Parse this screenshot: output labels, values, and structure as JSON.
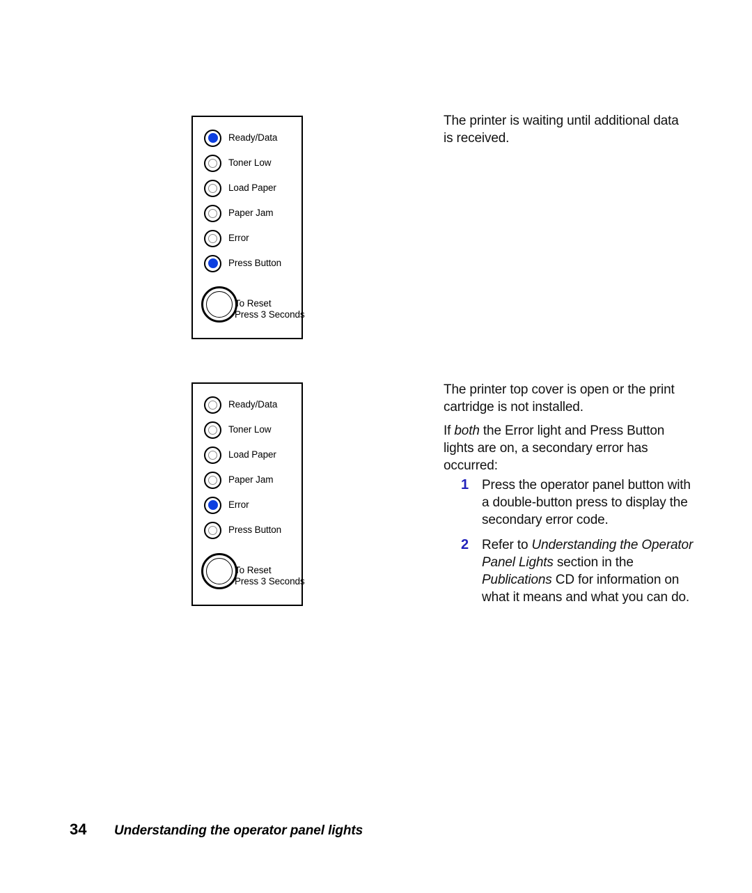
{
  "page": {
    "number": "34",
    "footer_title": "Understanding the operator panel lights"
  },
  "panels": [
    {
      "id": "panel-1",
      "lights": [
        {
          "label": "Ready/Data",
          "state": "on"
        },
        {
          "label": "Toner Low",
          "state": "off"
        },
        {
          "label": "Load Paper",
          "state": "off"
        },
        {
          "label": "Paper Jam",
          "state": "off"
        },
        {
          "label": "Error",
          "state": "off"
        },
        {
          "label": "Press Button",
          "state": "on"
        }
      ],
      "reset": {
        "line1": "To Reset",
        "line2": "Press 3 Seconds"
      }
    },
    {
      "id": "panel-2",
      "lights": [
        {
          "label": "Ready/Data",
          "state": "off"
        },
        {
          "label": "Toner Low",
          "state": "off"
        },
        {
          "label": "Load Paper",
          "state": "off"
        },
        {
          "label": "Paper Jam",
          "state": "off"
        },
        {
          "label": "Error",
          "state": "on"
        },
        {
          "label": "Press Button",
          "state": "off"
        }
      ],
      "reset": {
        "line1": "To Reset",
        "line2": "Press 3 Seconds"
      }
    }
  ],
  "descriptions": {
    "first": "The printer is waiting until additional data is received.",
    "second": "The printer top cover is open or the print cartridge is not installed.",
    "third_prefix": "If ",
    "third_italic": "both",
    "third_suffix": " the Error light and Press Button lights are on, a secondary error has occurred:"
  },
  "steps": [
    {
      "number": "1",
      "text": "Press the operator panel button with a double-button press to display the secondary error code."
    },
    {
      "number": "2",
      "parts": [
        {
          "text": "Refer to ",
          "style": "normal"
        },
        {
          "text": "Understanding the Operator Panel Lights",
          "style": "italic"
        },
        {
          "text": " section in the ",
          "style": "normal"
        },
        {
          "text": "Publications",
          "style": "italic"
        },
        {
          "text": " CD for information on what it means and what you can do.",
          "style": "normal"
        }
      ]
    }
  ],
  "colors": {
    "led_on": "#0d3fe0",
    "step_number": "#2222bb",
    "text": "#111111",
    "panel_border": "#000000"
  }
}
